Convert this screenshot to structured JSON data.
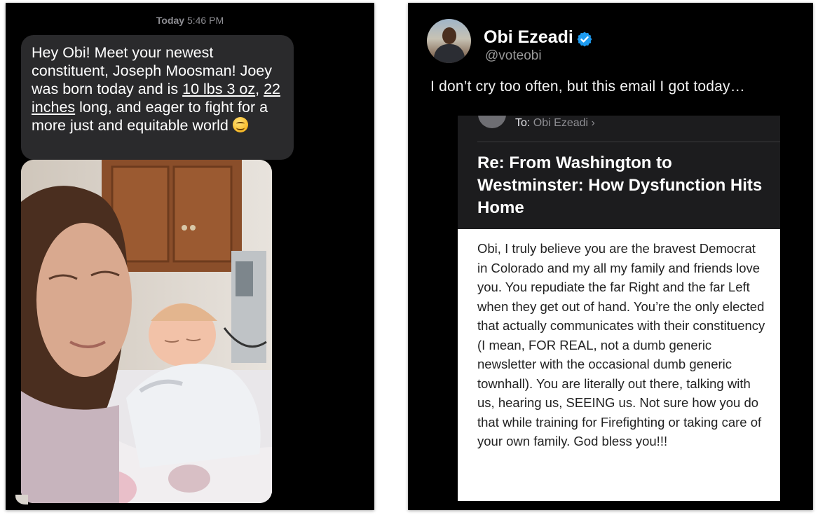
{
  "message_panel": {
    "timestamp_day": "Today",
    "timestamp_time": "5:46 PM",
    "bubble": {
      "part1": "Hey Obi! Meet your newest constituent, Joseph Moosman! Joey was born today and is ",
      "link1": "10 lbs 3 oz",
      "part2": ", ",
      "link2": "22 inches",
      "part3": " long, and eager to fight for a more just and equitable world ",
      "emoji": "smiling-face-emoji"
    },
    "photo_icon": "photo-of-mother-and-newborn"
  },
  "post_panel": {
    "author_name": "Obi Ezeadi",
    "author_handle": "@voteobi",
    "verified_icon": "verified-badge-icon",
    "post_text": "I don’t cry too often, but this email I got today…",
    "email": {
      "to_label": "To:",
      "to_name": "Obi Ezeadi",
      "chevron": "›",
      "subject": "Re: From Washington to Westminster: How Dysfunction Hits Home",
      "body": "Obi, I truly believe you are the bravest Democrat in Colorado and my all my family and friends love you. You repudiate the far Right and the far Left when they get out of hand. You’re the only elected that actually communicates with their constituency (I mean, FOR REAL, not a dumb generic newsletter with the occasional dumb generic townhall). You are literally out there, talking with us, hearing us, SEEING us. Not sure how you do that while training for Firefighting or taking care of your own family. God bless you!!!"
    }
  },
  "colors": {
    "panel_bg": "#000000",
    "bubble_bg": "#2a2a2c",
    "email_header_bg": "#1c1c1e",
    "verified_blue": "#1d9bf0"
  }
}
